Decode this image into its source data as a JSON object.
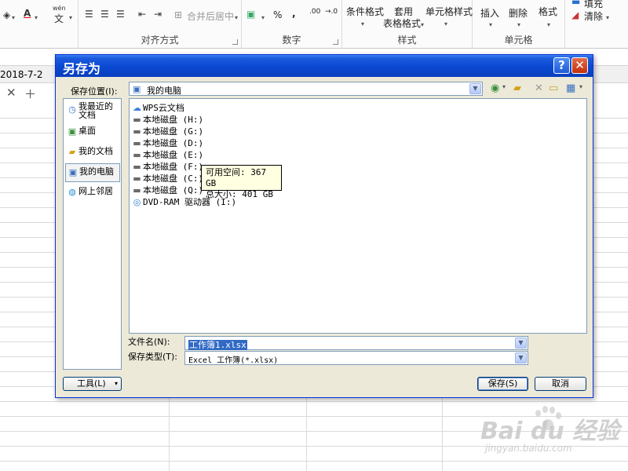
{
  "ribbon": {
    "row1": {
      "fill_label": "填充",
      "clear_label": "清除"
    },
    "buttons": {
      "merge_center": "合并后居中",
      "percent": "%",
      "comma": ",",
      "conditional_format": "条件格式",
      "table_format_1": "套用",
      "table_format_2": "表格格式",
      "cell_style": "单元格样式",
      "insert": "插入",
      "delete": "删除",
      "format": "格式"
    },
    "groups": {
      "alignment": "对齐方式",
      "number": "数字",
      "styles": "样式",
      "cells": "单元格"
    },
    "icons": {
      "wen": "wén",
      "wen_char": "文",
      "dec_inc": ".00",
      "dec_dec": "→.0"
    }
  },
  "sheet": {
    "cell_value": "2018-7-2"
  },
  "dialog": {
    "title": "另存为",
    "save_in_label": "保存位置(I):",
    "save_in_value": "我的电脑",
    "places": [
      {
        "label": "我最近的文档",
        "icon": "recent-documents-icon"
      },
      {
        "label": "桌面",
        "icon": "desktop-icon"
      },
      {
        "label": "我的文档",
        "icon": "my-documents-icon"
      },
      {
        "label": "我的电脑",
        "icon": "my-computer-icon"
      },
      {
        "label": "网上邻居",
        "icon": "network-icon"
      }
    ],
    "files": [
      {
        "label": "WPS云文档",
        "icon": "cloud-icon"
      },
      {
        "label": "本地磁盘 (H:)",
        "icon": "disk-icon"
      },
      {
        "label": "本地磁盘 (G:)",
        "icon": "disk-icon"
      },
      {
        "label": "本地磁盘 (D:)",
        "icon": "disk-icon"
      },
      {
        "label": "本地磁盘 (E:)",
        "icon": "disk-icon"
      },
      {
        "label": "本地磁盘 (F:)",
        "icon": "disk-icon"
      },
      {
        "label": "本地磁盘 (C:)",
        "icon": "disk-icon"
      },
      {
        "label": "本地磁盘 (Q:)",
        "icon": "disk-icon"
      },
      {
        "label": "DVD-RAM 驱动器 (I:)",
        "icon": "dvd-icon"
      }
    ],
    "tooltip": {
      "free_space": "可用空间: 367 GB",
      "total_size": "总大小: 401 GB"
    },
    "filename_label": "文件名(N):",
    "filename_value": "工作簿1.xlsx",
    "filetype_label": "保存类型(T):",
    "filetype_value": "Excel 工作簿(*.xlsx)",
    "tools_label": "工具(L)",
    "save_label": "保存(S)",
    "cancel_label": "取消",
    "help_label": "?",
    "close_label": "✕"
  },
  "watermark": {
    "brand": "Bai du 经验",
    "url": "jingyan.baidu.com"
  },
  "colors": {
    "titlebar": "#0a48d2",
    "dialog_bg": "#ece9d8",
    "selection": "#316ac5",
    "tooltip_bg": "#ffffe1"
  }
}
